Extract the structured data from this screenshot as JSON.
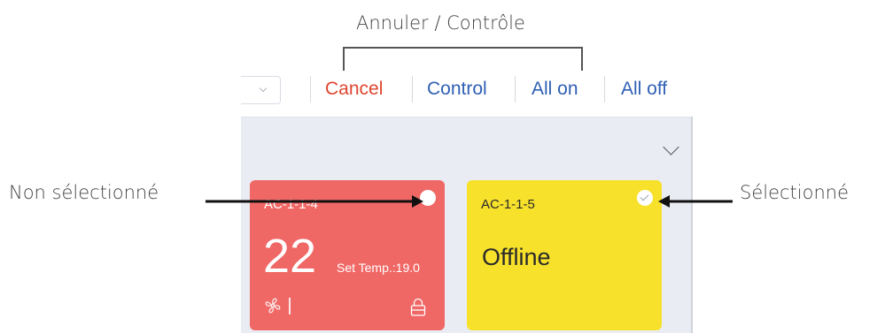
{
  "annotations": {
    "top": "Annuler / Contrôle",
    "left": "Non sélectionné",
    "right": "Sélectionné"
  },
  "toolbar": {
    "cancel_label": "Cancel",
    "control_label": "Control",
    "all_on_label": "All on",
    "all_off_label": "All off"
  },
  "cards": [
    {
      "name": "AC-1-1-4",
      "temperature": "22",
      "set_temp": "Set Temp.:19.0",
      "selected": false,
      "color": "#f06866"
    },
    {
      "name": "AC-1-1-5",
      "status": "Offline",
      "selected": true,
      "color": "#f7e12b"
    }
  ],
  "colors": {
    "cancel": "#e0452f",
    "action": "#2f5fb3",
    "panel_background": "#e9ecf2"
  }
}
